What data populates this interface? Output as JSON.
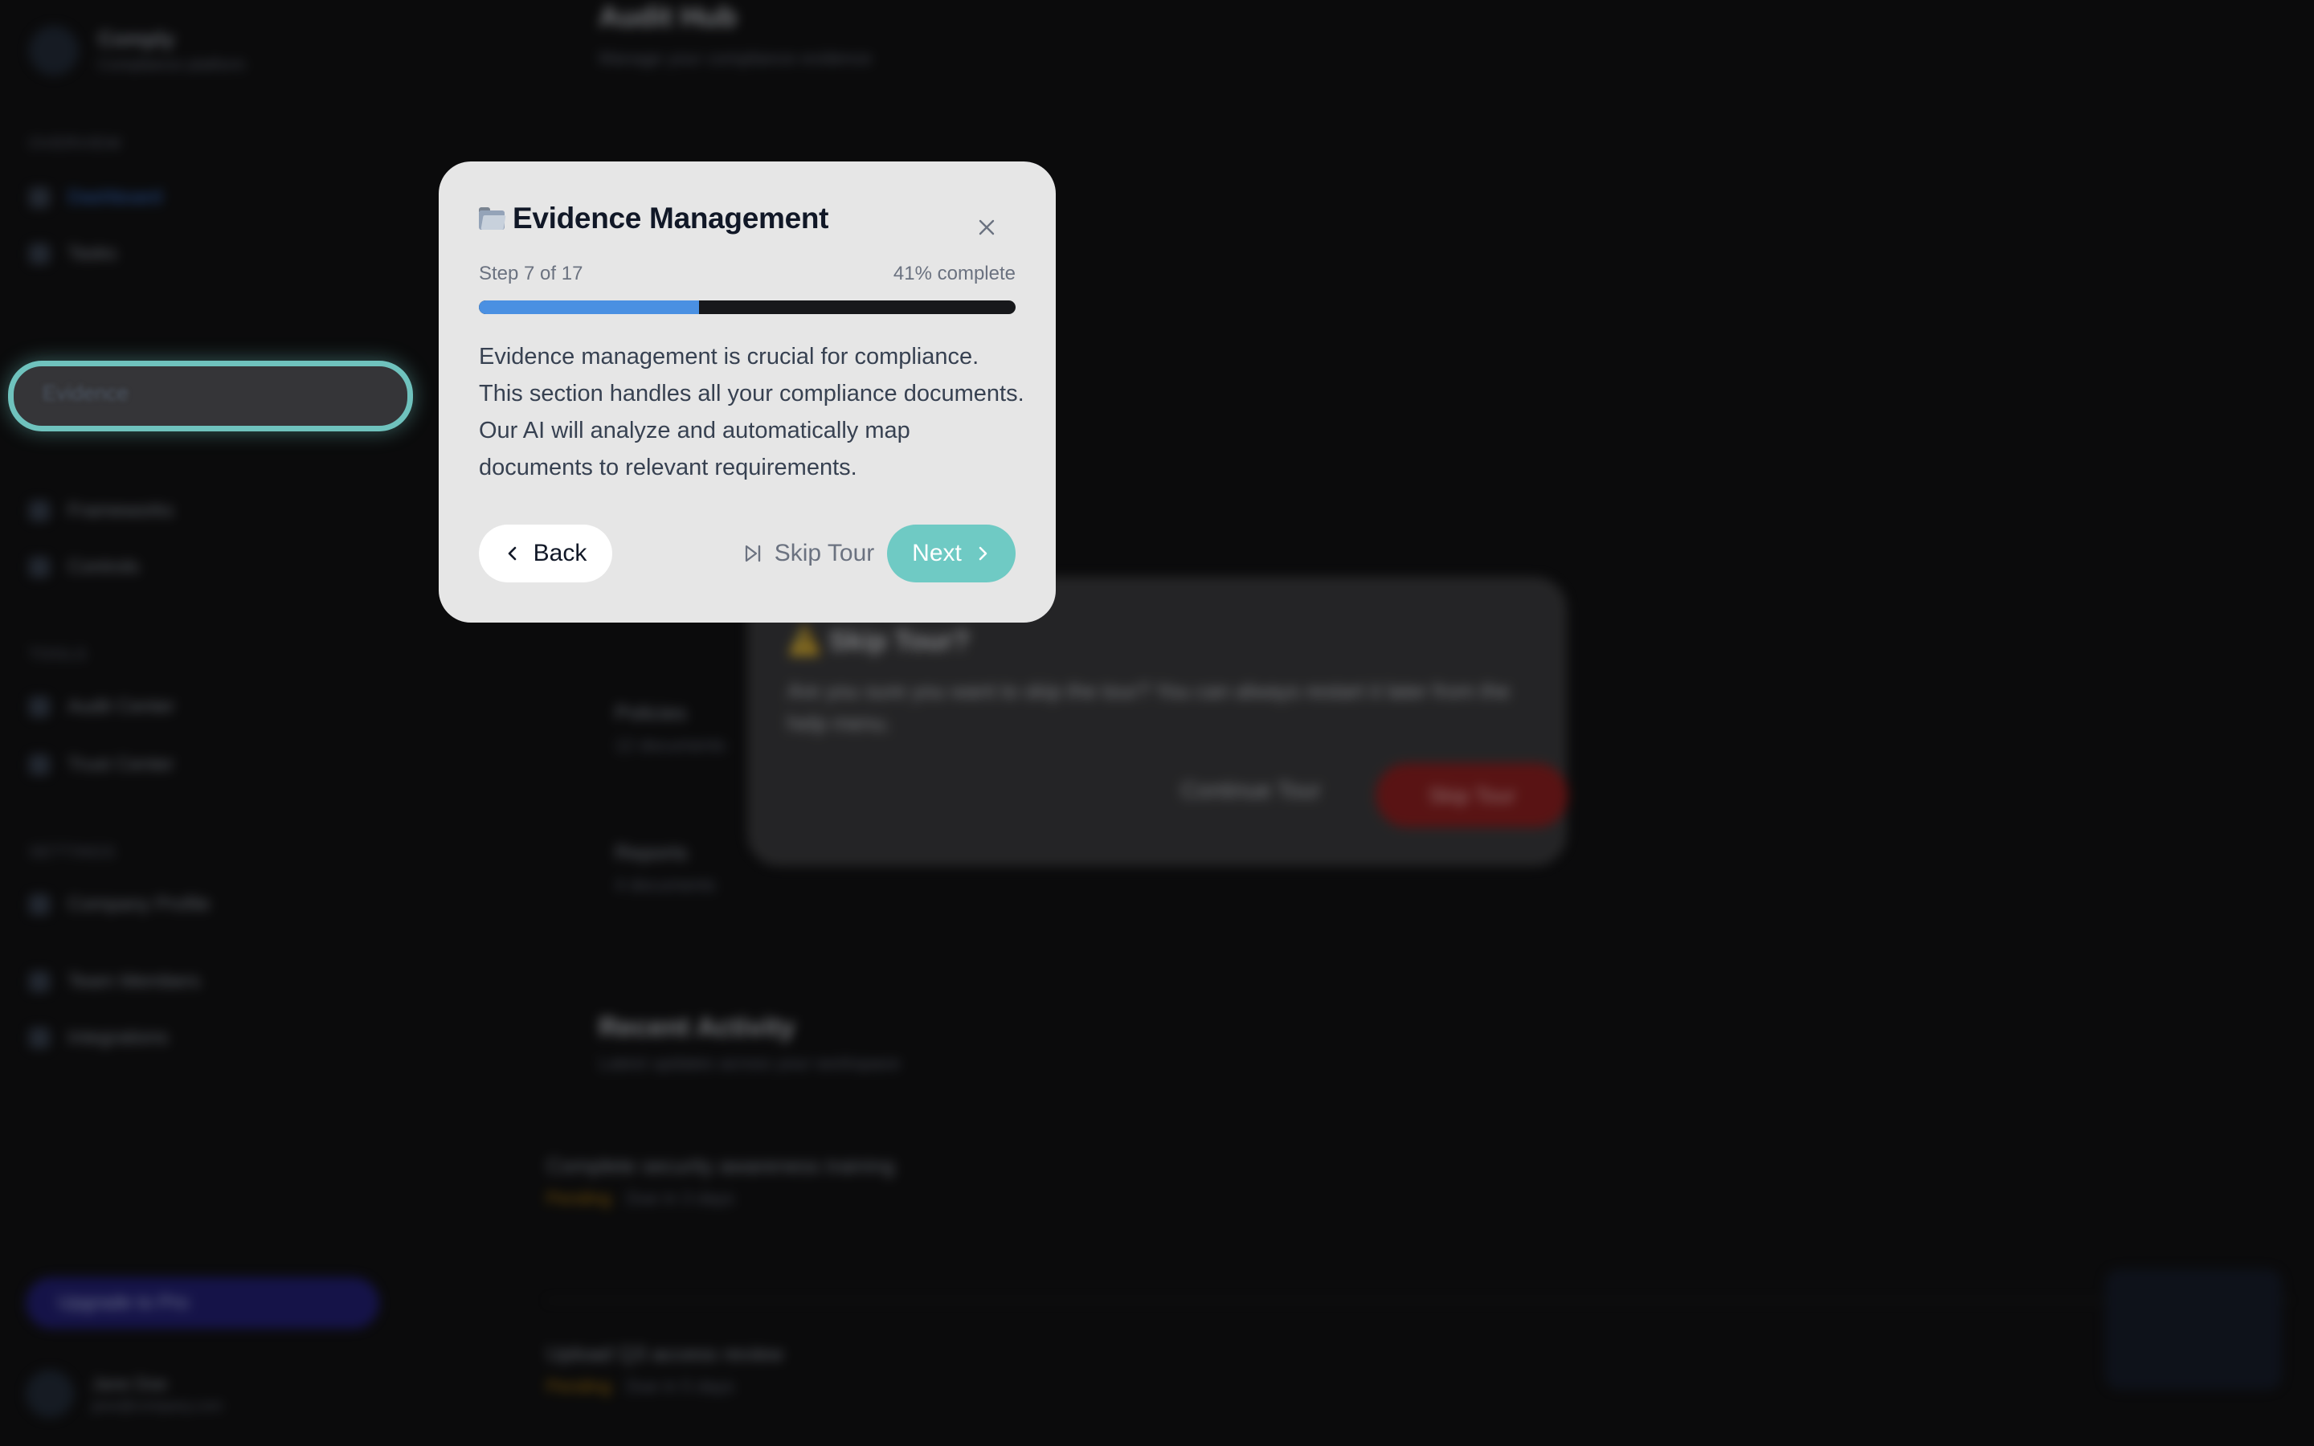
{
  "background": {
    "brand": {
      "name": "Comply",
      "subtitle": "Compliance platform"
    },
    "nav": {
      "section_main": "OVERVIEW",
      "items_top": [
        "Dashboard",
        "Tasks"
      ],
      "highlighted_item": "Evidence",
      "items_mid": [
        "Frameworks",
        "Controls"
      ],
      "section_tools": "TOOLS",
      "items_tools": [
        "Audit Center",
        "Trust Center"
      ],
      "section_settings": "SETTINGS",
      "items_settings": [
        "Company Profile",
        "Team Members",
        "Integrations"
      ]
    },
    "upgrade_label": "Upgrade to Pro",
    "user": {
      "name": "Jane Doe",
      "email": "jane@company.com"
    },
    "header": {
      "title": "Audit Hub",
      "subtitle": "Manage your compliance evidence"
    },
    "skip_dialog": {
      "emoji": "⚠️",
      "title": "Skip Tour?",
      "text": "Are you sure you want to skip the tour? You can always restart it later from the help menu.",
      "continue_label": "Continue Tour",
      "skip_label": "Skip Tour"
    },
    "rows": [
      {
        "title": "Policies",
        "sub": "12 documents"
      },
      {
        "title": "Reports",
        "sub": "4 documents"
      }
    ],
    "section": {
      "title": "Recent Activity",
      "subtitle": "Latest updates across your workspace"
    },
    "activity": [
      {
        "title": "Complete security awareness training",
        "status": "Pending",
        "sub": "Due in 3 days"
      },
      {
        "title": "Upload Q3 access review",
        "status": "Pending",
        "sub": "Due in 5 days"
      }
    ]
  },
  "tour": {
    "title": "Evidence Management",
    "title_icon": "folder-icon",
    "step_label": "Step 7 of 17",
    "percent_label": "41% complete",
    "progress_fraction": 0.41,
    "body": "Evidence management is crucial for compliance. This section handles all your compliance documents. Our AI will analyze and automatically map documents to relevant requirements.",
    "back_label": "Back",
    "skip_label": "Skip Tour",
    "next_label": "Next",
    "colors": {
      "accent": "#6fcac4",
      "progress": "#4a90e2",
      "track": "#17181b",
      "modal_bg": "#e6e6e6"
    }
  }
}
